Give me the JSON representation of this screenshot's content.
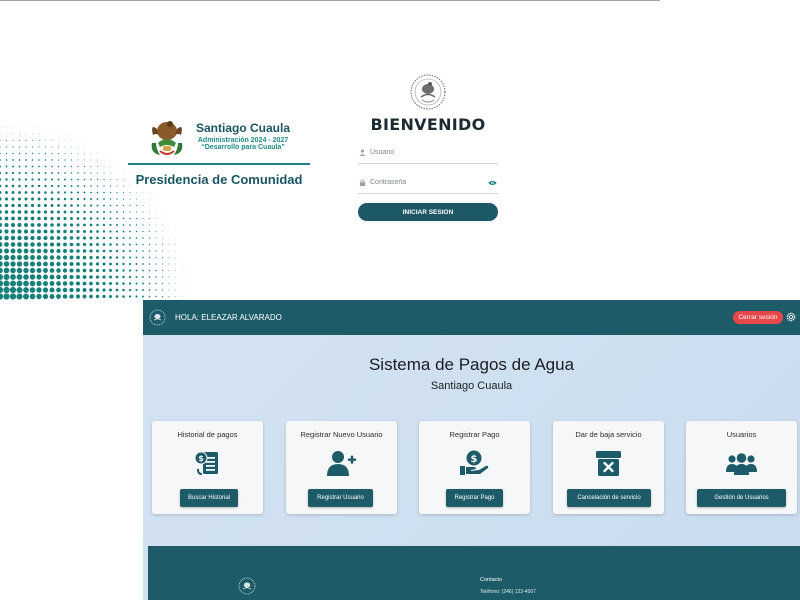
{
  "login": {
    "municipality": "Santiago Cuaula",
    "administration": "Administración 2024 - 2027",
    "slogan": "“Desarrollo para Cuaula”",
    "presidency": "Presidencia de Comunidad",
    "welcome": "BIENVENIDO",
    "username_placeholder": "Usuario",
    "password_placeholder": "Contraseña",
    "login_button": "INICIAR SESION",
    "colors": {
      "brand": "#1d5866",
      "accent": "#1f8a84",
      "dots": "#17807b"
    }
  },
  "dashboard": {
    "greeting": "HOLA: ELEAZAR ALVARADO",
    "logout_button": "Cerrar sesión",
    "title": "Sistema de Pagos de Agua",
    "subtitle": "Santiago Cuaula",
    "cards": [
      {
        "title": "Historial de pagos",
        "icon": "receipt-dollar-icon",
        "button": "Buscar Historial"
      },
      {
        "title": "Registrar Nuevo Usuario",
        "icon": "user-plus-icon",
        "button": "Registrar Usuario"
      },
      {
        "title": "Registrar Pago",
        "icon": "hand-dollar-icon",
        "button": "Registrar Pago"
      },
      {
        "title": "Dar de baja servicio",
        "icon": "box-x-icon",
        "button": "Cancelación de servicio"
      },
      {
        "title": "Usuarios",
        "icon": "users-icon",
        "button": "Gestión de Usuarios"
      }
    ],
    "footer": {
      "contact_title": "Contacto",
      "phone": "Teléfono: (246) 123-4567"
    },
    "colors": {
      "header": "#1d5b69",
      "logout": "#e8474a",
      "background": "#d1e1f1"
    }
  }
}
